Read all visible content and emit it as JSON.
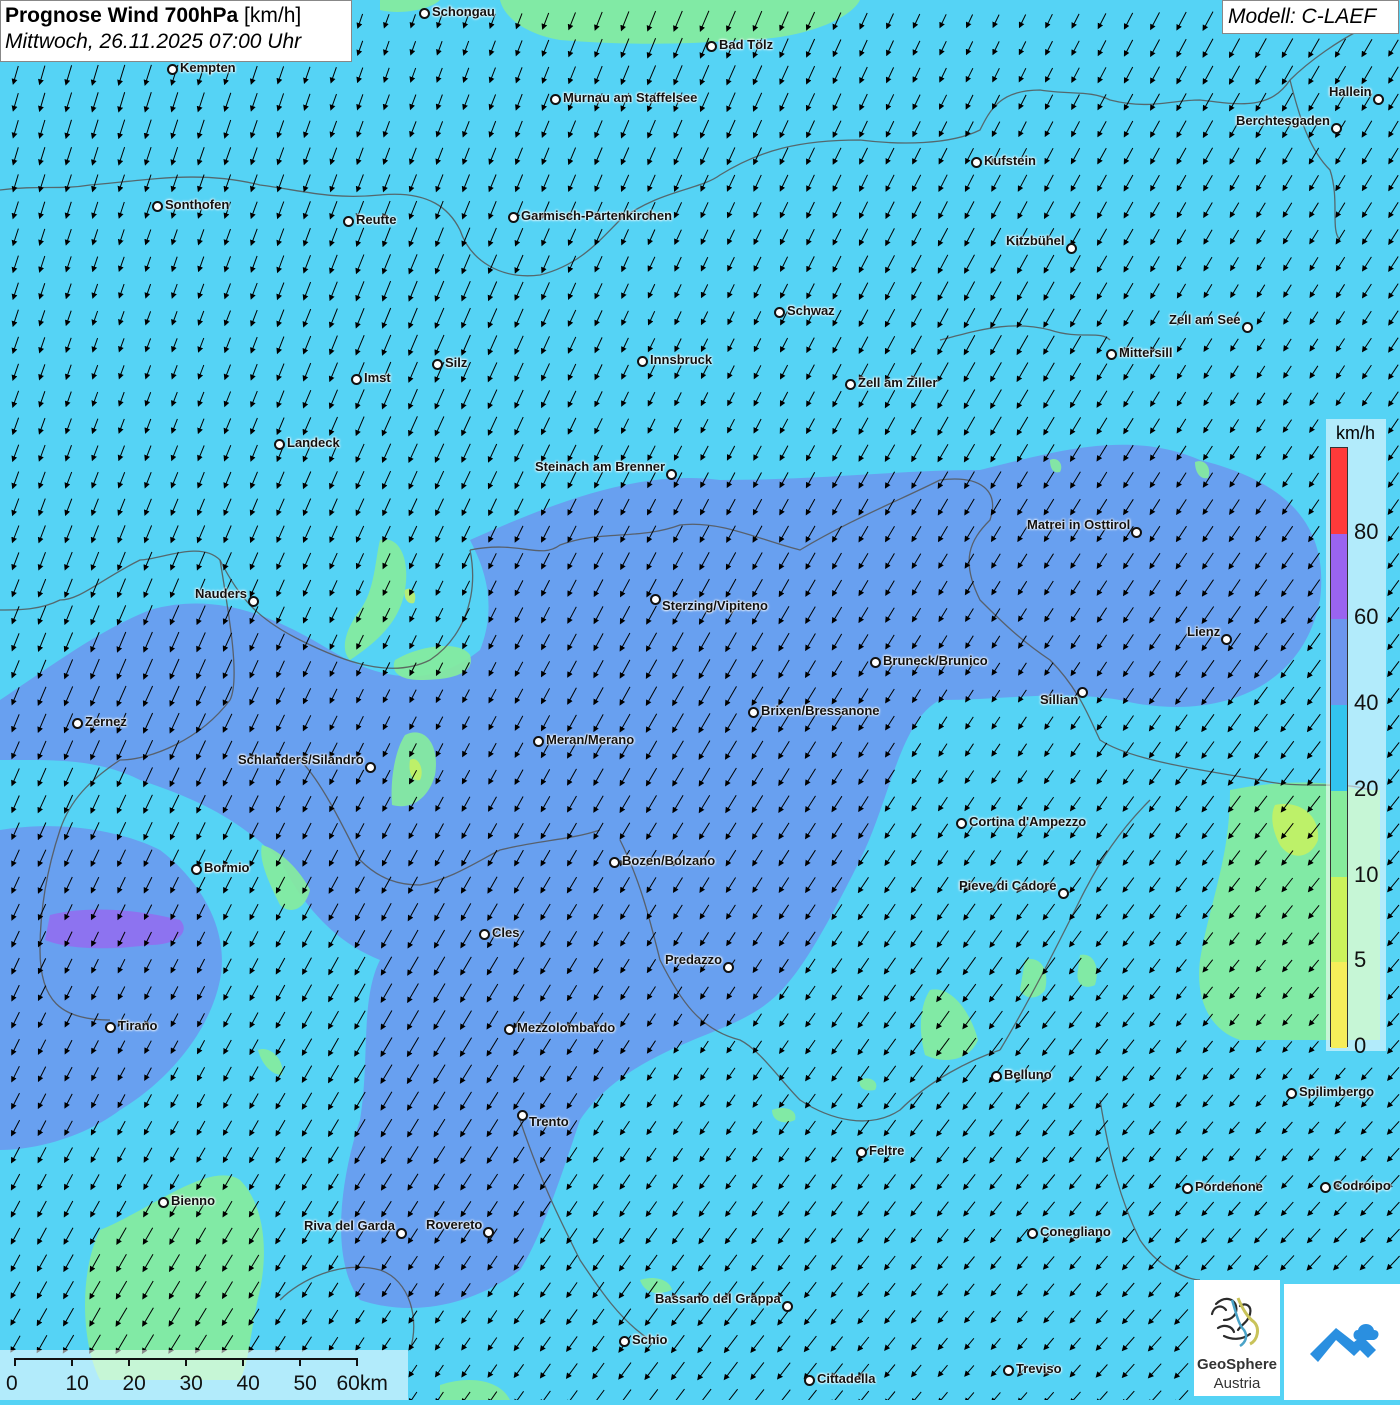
{
  "title": {
    "main": "Prognose Wind 700hPa",
    "unit": "[km/h]",
    "datetime": "Mittwoch, 26.11.2025 07:00 Uhr"
  },
  "model": "Modell: C-LAEF",
  "legend": {
    "unit": "km/h",
    "ticks": [
      "80",
      "60",
      "40",
      "20",
      "10",
      "5",
      "0"
    ],
    "colors": [
      "#ff3a3a",
      "#9a64f0",
      "#6c96ee",
      "#33c4ee",
      "#86ec9c",
      "#ccf35a",
      "#f6ee5a"
    ]
  },
  "scale": {
    "labels": [
      "0",
      "10",
      "20",
      "30",
      "40",
      "50",
      "60km"
    ]
  },
  "logo": {
    "name_line1": "GeoSphere",
    "name_line2": "Austria"
  },
  "wind": {
    "prevailing_direction": "from north-north-east",
    "speed_range_kmh": [
      10,
      60
    ]
  },
  "places": [
    {
      "name": "Schongau"
    },
    {
      "name": "Bad Tölz"
    },
    {
      "name": "Kempten"
    },
    {
      "name": "Murnau am Staffelsee"
    },
    {
      "name": "Hallein"
    },
    {
      "name": "Berchtesgaden"
    },
    {
      "name": "Kufstein"
    },
    {
      "name": "Sonthofen"
    },
    {
      "name": "Reutte"
    },
    {
      "name": "Garmisch-Partenkirchen"
    },
    {
      "name": "Kitzbühel"
    },
    {
      "name": "Schwaz"
    },
    {
      "name": "Zell am See"
    },
    {
      "name": "Mittersill"
    },
    {
      "name": "Innsbruck"
    },
    {
      "name": "Silz"
    },
    {
      "name": "Imst"
    },
    {
      "name": "Zell am Ziller"
    },
    {
      "name": "Landeck"
    },
    {
      "name": "Steinach am Brenner"
    },
    {
      "name": "Matrei in Osttirol"
    },
    {
      "name": "Nauders"
    },
    {
      "name": "Sterzing/Vipiteno"
    },
    {
      "name": "Lienz"
    },
    {
      "name": "Bruneck/Brunico"
    },
    {
      "name": "Sillian"
    },
    {
      "name": "Zernez"
    },
    {
      "name": "Brixen/Bressanone"
    },
    {
      "name": "Meran/Merano"
    },
    {
      "name": "Schlanders/Silandro"
    },
    {
      "name": "Cortina d'Ampezzo"
    },
    {
      "name": "Bormio"
    },
    {
      "name": "Bozen/Bolzano"
    },
    {
      "name": "Pieve di Cadore"
    },
    {
      "name": "Cles"
    },
    {
      "name": "Predazzo"
    },
    {
      "name": "Tirano"
    },
    {
      "name": "Mezzolombardo"
    },
    {
      "name": "Belluno"
    },
    {
      "name": "Spilimbergo"
    },
    {
      "name": "Trento"
    },
    {
      "name": "Feltre"
    },
    {
      "name": "Pordenone"
    },
    {
      "name": "Codroipo"
    },
    {
      "name": "Bienno"
    },
    {
      "name": "Riva del Garda"
    },
    {
      "name": "Rovereto"
    },
    {
      "name": "Conegliano"
    },
    {
      "name": "Bassano del Grappa"
    },
    {
      "name": "Schio"
    },
    {
      "name": "Treviso"
    },
    {
      "name": "Cittadella"
    }
  ]
}
